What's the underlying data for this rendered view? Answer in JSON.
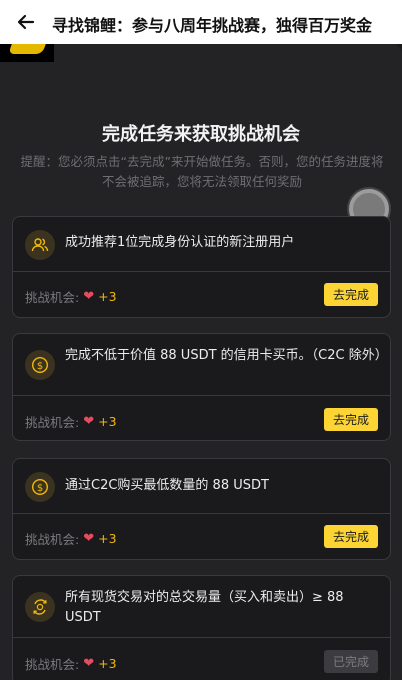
{
  "header": {
    "title": "寻找锦鲤：参与八周年挑战赛，独得百万奖金"
  },
  "main": {
    "heading": "完成任务来获取挑战机会",
    "tip": "提醒：您必须点击“去完成”来开始做任务。否则，您的任务进度将不会被追踪，您将无法领取任何奖励"
  },
  "tasks": [
    {
      "icon": "users-icon",
      "description": "成功推荐1位完成身份认证的新注册用户",
      "chance_label": "挑战机会:",
      "chance_value": "+3",
      "button_label": "去完成",
      "completed": false
    },
    {
      "icon": "dollar-coin-icon",
      "description": "完成不低于价值 88 USDT 的信用卡买币。（C2C 除外）",
      "chance_label": "挑战机会:",
      "chance_value": "+3",
      "button_label": "去完成",
      "completed": false
    },
    {
      "icon": "dollar-coin-icon",
      "description": "通过C2C购买最低数量的 88 USDT",
      "chance_label": "挑战机会:",
      "chance_value": "+3",
      "button_label": "去完成",
      "completed": false
    },
    {
      "icon": "exchange-coin-icon",
      "description": "所有现货交易对的总交易量（买入和卖出）≥ 88 USDT",
      "chance_label": "挑战机会:",
      "chance_value": "+3",
      "button_label": "已完成",
      "completed": true
    }
  ],
  "colors": {
    "accent": "#fcd535",
    "heart": "#e84a5f",
    "chance_value": "#f0b90b"
  }
}
